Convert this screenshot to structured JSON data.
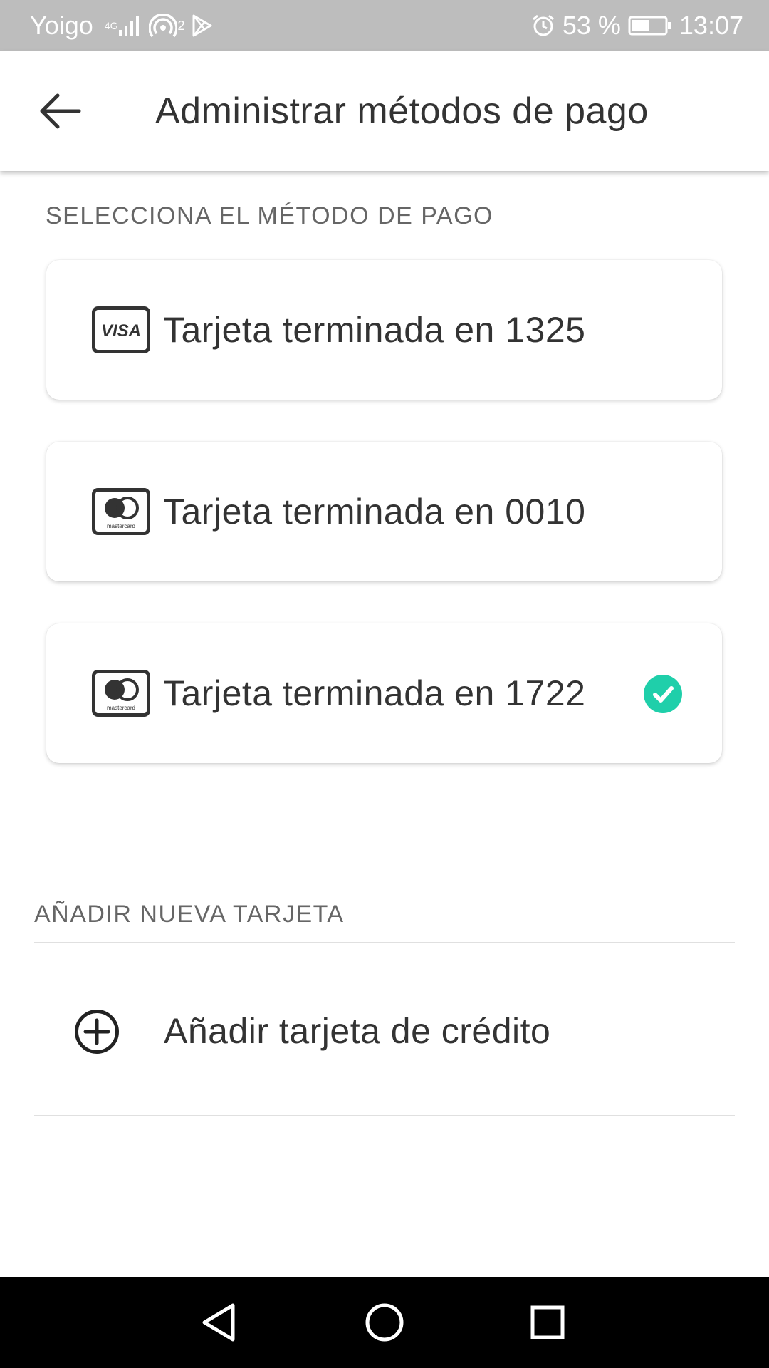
{
  "status_bar": {
    "carrier": "Yoigo",
    "network_type": "4G",
    "hotspot_count": "2",
    "battery_percent": "53 %",
    "battery_level": 0.53,
    "time": "13:07",
    "icons": [
      "signal-icon",
      "hotspot-icon",
      "play-store-icon",
      "alarm-icon",
      "battery-icon"
    ]
  },
  "app_bar": {
    "back_icon": "arrow-left-icon",
    "title": "Administrar métodos de pago"
  },
  "payment_section": {
    "label": "SELECCIONA EL MÉTODO DE PAGO",
    "cards": [
      {
        "brand": "visa",
        "brand_text": "VISA",
        "label": "Tarjeta terminada en 1325",
        "selected": false
      },
      {
        "brand": "mastercard",
        "brand_text": "mastercard",
        "label": "Tarjeta terminada en 0010",
        "selected": false
      },
      {
        "brand": "mastercard",
        "brand_text": "mastercard",
        "label": "Tarjeta terminada en 1722",
        "selected": true
      }
    ]
  },
  "add_section": {
    "label": "AÑADIR NUEVA TARJETA",
    "add_button_label": "Añadir tarjeta de crédito",
    "add_icon": "plus-circle-icon"
  },
  "nav_bar": {
    "buttons": [
      "back-triangle-icon",
      "home-circle-icon",
      "recents-square-icon"
    ]
  },
  "colors": {
    "status_bar_bg": "#bdbdbd",
    "selected_check": "#1fcfaa",
    "text_primary": "#333333",
    "text_secondary": "#666666",
    "nav_bar_bg": "#000000"
  }
}
